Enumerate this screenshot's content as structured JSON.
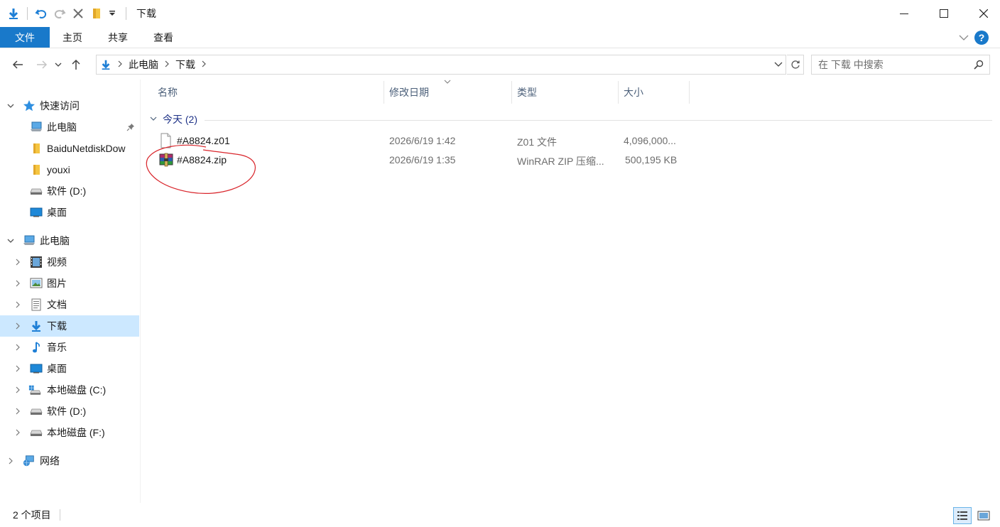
{
  "window": {
    "title": "下载",
    "minimize_glyph": "—",
    "maximize_glyph": "☐",
    "close_glyph": "✕"
  },
  "ribbon": {
    "tabs": [
      {
        "label": "文件",
        "active": true
      },
      {
        "label": "主页"
      },
      {
        "label": "共享"
      },
      {
        "label": "查看"
      }
    ],
    "help_label": "?"
  },
  "address": {
    "crumbs": [
      "此电脑",
      "下载"
    ],
    "search_placeholder": "在 下载 中搜索"
  },
  "sidebar": {
    "quick_access": {
      "label": "快速访问",
      "items": [
        {
          "label": "此电脑",
          "icon": "computer-icon",
          "pinned": true
        },
        {
          "label": "BaiduNetdiskDow",
          "icon": "folder-icon"
        },
        {
          "label": "youxi",
          "icon": "folder-icon"
        },
        {
          "label": "软件 (D:)",
          "icon": "drive-icon"
        },
        {
          "label": "桌面",
          "icon": "desktop-icon"
        }
      ]
    },
    "this_pc": {
      "label": "此电脑",
      "items": [
        {
          "label": "视频",
          "icon": "video-icon"
        },
        {
          "label": "图片",
          "icon": "pictures-icon"
        },
        {
          "label": "文档",
          "icon": "documents-icon"
        },
        {
          "label": "下载",
          "icon": "downloads-icon",
          "selected": true
        },
        {
          "label": "音乐",
          "icon": "music-icon"
        },
        {
          "label": "桌面",
          "icon": "desktop-icon"
        },
        {
          "label": "本地磁盘 (C:)",
          "icon": "system-drive-icon"
        },
        {
          "label": "软件 (D:)",
          "icon": "drive-icon"
        },
        {
          "label": "本地磁盘 (F:)",
          "icon": "drive-icon"
        }
      ]
    },
    "network": {
      "label": "网络",
      "icon": "network-icon"
    }
  },
  "file_list": {
    "columns": [
      "名称",
      "修改日期",
      "类型",
      "大小"
    ],
    "group_label": "今天 (2)",
    "files": [
      {
        "name": "#A8824.z01",
        "date": "2026/6/19 1:42",
        "type": "Z01 文件",
        "size": "4,096,000...",
        "icon": "blank-file-icon"
      },
      {
        "name": "#A8824.zip",
        "date": "2026/6/19 1:35",
        "type": "WinRAR ZIP 压缩...",
        "size": "500,195 KB",
        "icon": "winrar-archive-icon"
      }
    ]
  },
  "status": {
    "item_count": "2 个项目"
  },
  "colors": {
    "accent": "#1979ca",
    "selection": "#cce8ff",
    "annotation": "#d9262c"
  }
}
